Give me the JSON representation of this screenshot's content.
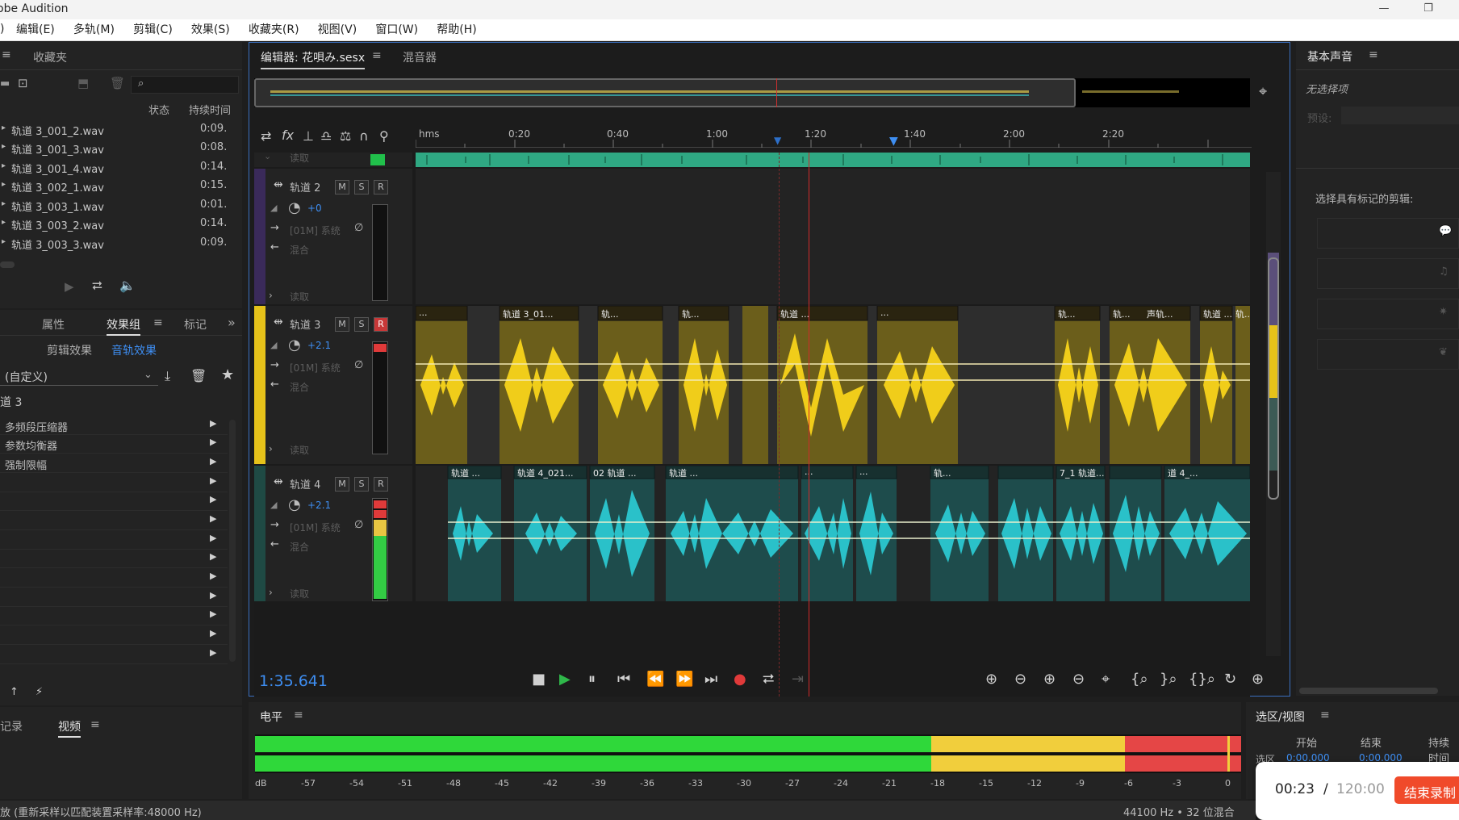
{
  "app": {
    "title": "obe Audition"
  },
  "window_controls": [
    "—",
    "❐"
  ],
  "menu": [
    "编辑(E)",
    "多轨(M)",
    "剪辑(C)",
    "效果(S)",
    "收藏夹(R)",
    "视图(V)",
    "窗口(W)",
    "帮助(H)"
  ],
  "files_panel": {
    "tab": "收藏夹",
    "col_status": "状态",
    "col_duration": "持续时间",
    "files": [
      {
        "name": "轨道 3_001_2.wav",
        "duration": "0:09."
      },
      {
        "name": "轨道 3_001_3.wav",
        "duration": "0:08."
      },
      {
        "name": "轨道 3_001_4.wav",
        "duration": "0:14."
      },
      {
        "name": "轨道 3_002_1.wav",
        "duration": "0:15."
      },
      {
        "name": "轨道 3_003_1.wav",
        "duration": "0:01."
      },
      {
        "name": "轨道 3_003_2.wav",
        "duration": "0:14."
      },
      {
        "name": "轨道 3_003_3.wav",
        "duration": "0:09."
      }
    ]
  },
  "effects_panel": {
    "tabs": [
      "属性",
      "效果组",
      "标记"
    ],
    "subtabs": [
      "剪辑效果",
      "音轨效果"
    ],
    "preset": "(自定义)",
    "track_label": "道 3",
    "effects": [
      "多频段压缩器",
      "参数均衡器",
      "强制限幅",
      "",
      "",
      "",
      "",
      "",
      "",
      "",
      "",
      "",
      ""
    ]
  },
  "bottom_left_tabs": [
    "记录",
    "视频"
  ],
  "editor": {
    "tab_editor": "编辑器: 花唄み.sesx",
    "tab_mixer": "混音器",
    "ruler_labels": [
      "hms",
      "0:20",
      "0:40",
      "1:00",
      "1:20",
      "1:40",
      "2:00",
      "2:20"
    ],
    "time_display": "1:35.641"
  },
  "tracks": [
    {
      "name": "轨道 2",
      "volume": "+0",
      "input": "[01M] 系统",
      "output": "混合",
      "mode": "读取",
      "color": "#5b3d8a"
    },
    {
      "name": "轨道 3",
      "volume": "+2.1",
      "input": "[01M] 系统",
      "output": "混合",
      "mode": "读取",
      "color": "#e6c21a"
    },
    {
      "name": "轨道 4",
      "volume": "+2.1",
      "input": "[01M] 系统",
      "output": "混合",
      "mode": "读取",
      "color": "#2a7a6e"
    }
  ],
  "track_top_mode": "读取",
  "track3_clips": [
    "...",
    "轨道 3_01...",
    "轨...",
    "轨...",
    "轨道 ...",
    "...",
    "轨...",
    "轨...",
    "声轨...",
    "轨道 ...",
    "轨..."
  ],
  "track4_clips": [
    "轨道 ...",
    "轨道 4_021...",
    "02 轨道 ...",
    "轨道 ...",
    "...",
    "...",
    "轨...",
    "7_1 轨道...",
    "道 4_..."
  ],
  "msr": [
    "M",
    "S",
    "R"
  ],
  "levels": {
    "title": "电平",
    "scale": [
      "dB",
      "-57",
      "-54",
      "-51",
      "-48",
      "-45",
      "-42",
      "-39",
      "-36",
      "-33",
      "-30",
      "-27",
      "-24",
      "-21",
      "-18",
      "-15",
      "-12",
      "-9",
      "-6",
      "-3",
      "0"
    ],
    "colors": {
      "green": "#2fd83a",
      "yellow": "#f1ce3c",
      "red": "#e54646"
    }
  },
  "essential_sound": {
    "title": "基本声音",
    "no_selection": "无选择项",
    "preset_label": "预设:",
    "clips_label": "选择具有标记的剪辑:"
  },
  "selection_view": {
    "title": "选区/视图",
    "cols": [
      "开始",
      "结束",
      "持续时间"
    ],
    "row_label": "选区",
    "start": "0:00.000",
    "end": "0:00.000"
  },
  "recording": {
    "elapsed": "00:23",
    "sep": "/",
    "limit": "120:00",
    "end_button": "结束录制"
  },
  "status": {
    "left": "放  (重新采样以匹配装置采样率:48000 Hz)",
    "right": "44100 Hz • 32 位混合"
  },
  "accent": "#3e8ef2"
}
